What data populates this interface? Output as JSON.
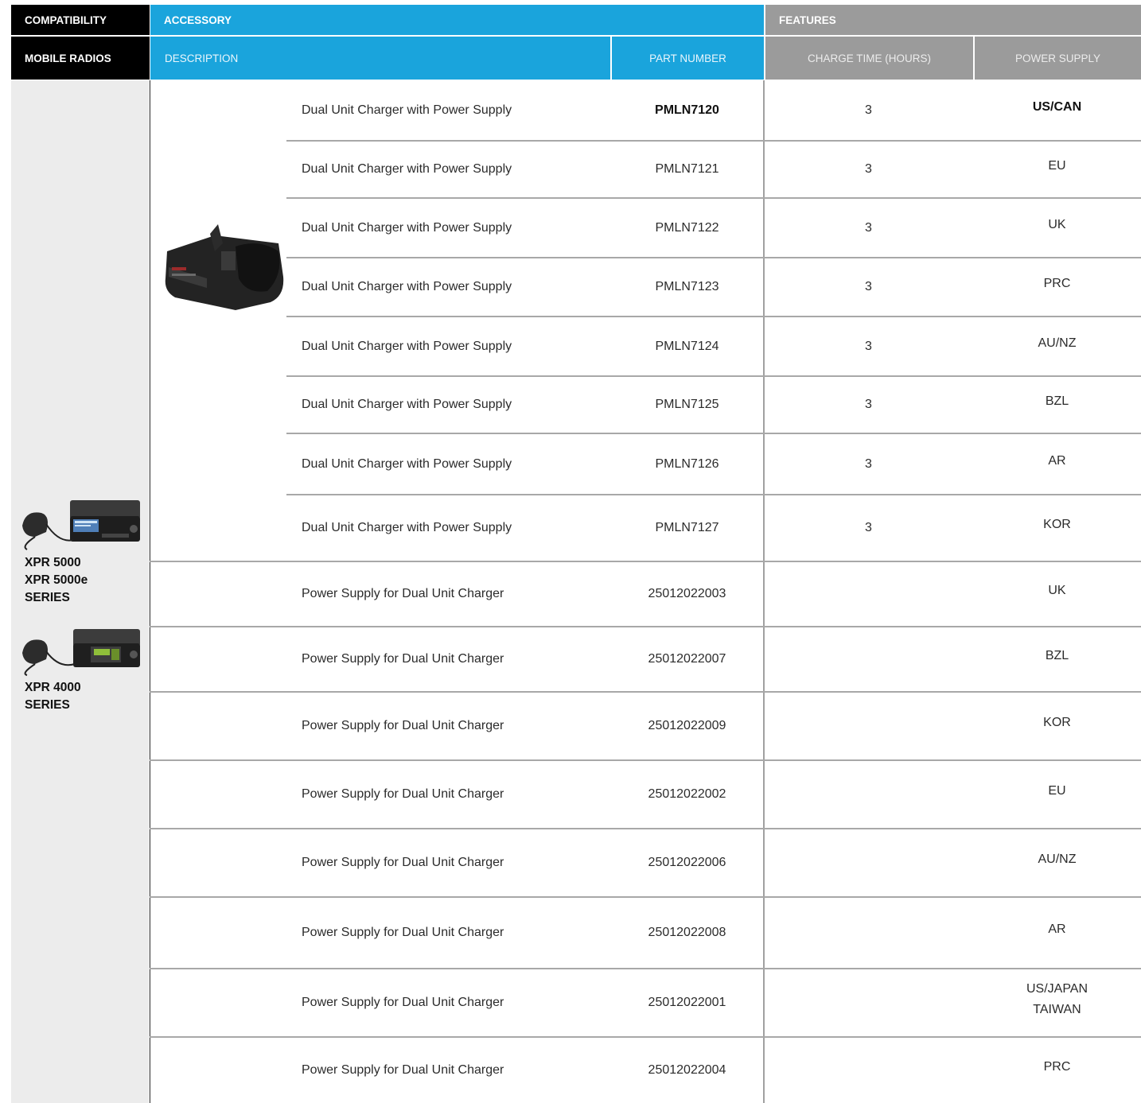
{
  "header": {
    "compatibility": "COMPATIBILITY",
    "accessory": "ACCESSORY",
    "features": "FEATURES",
    "mobile_radios": "MOBILE RADIOS",
    "description": "DESCRIPTION",
    "part_number": "PART NUMBER",
    "charge_time": "CHARGE TIME (HOURS)",
    "power_supply": "POWER SUPPLY"
  },
  "compatibility": {
    "group1": [
      "XPR 5000",
      "XPR 5000e",
      "SERIES"
    ],
    "group2": [
      "XPR 4000",
      "SERIES"
    ]
  },
  "colors": {
    "black_header": "#000000",
    "blue_header": "#1aa4dc",
    "grey_header": "#9b9b9b",
    "compat_bg": "#ececec"
  },
  "rows": [
    {
      "description": "Dual Unit Charger with Power Supply",
      "part_number": "PMLN7120",
      "charge_time": "3",
      "power_supply": "US/CAN",
      "bold": true
    },
    {
      "description": "Dual Unit Charger with Power Supply",
      "part_number": "PMLN7121",
      "charge_time": "3",
      "power_supply": "EU"
    },
    {
      "description": "Dual Unit Charger with Power Supply",
      "part_number": "PMLN7122",
      "charge_time": "3",
      "power_supply": "UK"
    },
    {
      "description": "Dual Unit Charger with Power Supply",
      "part_number": "PMLN7123",
      "charge_time": "3",
      "power_supply": "PRC"
    },
    {
      "description": "Dual Unit Charger with Power Supply",
      "part_number": "PMLN7124",
      "charge_time": "3",
      "power_supply": "AU/NZ"
    },
    {
      "description": "Dual Unit Charger with Power Supply",
      "part_number": "PMLN7125",
      "charge_time": "3",
      "power_supply": "BZL"
    },
    {
      "description": "Dual Unit Charger with Power Supply",
      "part_number": "PMLN7126",
      "charge_time": "3",
      "power_supply": "AR"
    },
    {
      "description": "Dual Unit Charger with Power Supply",
      "part_number": "PMLN7127",
      "charge_time": "3",
      "power_supply": "KOR"
    },
    {
      "description": "Power Supply for Dual Unit Charger",
      "part_number": "25012022003",
      "charge_time": "",
      "power_supply": "UK"
    },
    {
      "description": "Power Supply for Dual Unit Charger",
      "part_number": "25012022007",
      "charge_time": "",
      "power_supply": "BZL"
    },
    {
      "description": "Power Supply for Dual Unit Charger",
      "part_number": "25012022009",
      "charge_time": "",
      "power_supply": "KOR"
    },
    {
      "description": "Power Supply for Dual Unit Charger",
      "part_number": "25012022002",
      "charge_time": "",
      "power_supply": "EU"
    },
    {
      "description": "Power Supply for Dual Unit Charger",
      "part_number": "25012022006",
      "charge_time": "",
      "power_supply": "AU/NZ"
    },
    {
      "description": "Power Supply for Dual Unit Charger",
      "part_number": "25012022008",
      "charge_time": "",
      "power_supply": "AR"
    },
    {
      "description": "Power Supply for Dual Unit Charger",
      "part_number": "25012022001",
      "charge_time": "",
      "power_supply": "US/JAPAN\nTAIWAN"
    },
    {
      "description": "Power Supply for Dual Unit Charger",
      "part_number": "25012022004",
      "charge_time": "",
      "power_supply": "PRC"
    }
  ]
}
